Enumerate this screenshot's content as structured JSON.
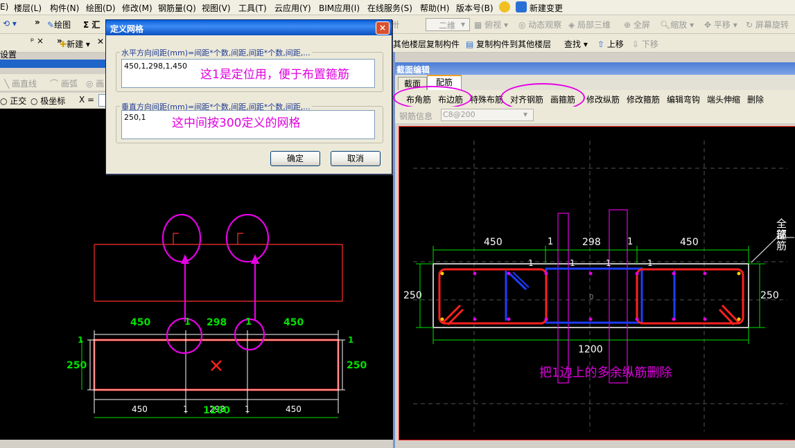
{
  "menubar": {
    "items": [
      "E)",
      "楼层(L)",
      "构件(N)",
      "绘图(D)",
      "修改(M)",
      "钢筋量(Q)",
      "视图(V)",
      "工具(T)",
      "云应用(Y)",
      "BIM应用(I)",
      "在线服务(S)",
      "帮助(H)",
      "版本号(B)",
      "新建变更"
    ]
  },
  "toolbar1": {
    "undo": "⟲ ▾",
    "draw": "绘图",
    "sum": "Σ 汇",
    "right_items": [
      "二维",
      "俯视",
      "动态观察",
      "局部三维",
      "全屏",
      "缩放",
      "平移",
      "屏幕旋转"
    ]
  },
  "toolbar2": {
    "panel_label": "设置",
    "pin": "ᵖ ×",
    "new_button": "新建",
    "copy_from_other": "其他楼层复制构件",
    "copy_to_other": "复制构件到其他楼层",
    "find": "查找",
    "up": "上移",
    "down": "下移"
  },
  "left_panel": {
    "tools": [
      "画直线",
      "画弧",
      "画"
    ],
    "ortho": "正交",
    "polar": "极坐标",
    "x_label": "X ="
  },
  "dialog": {
    "title": "定义网格",
    "close": "×",
    "h_group_label": "水平方向间距(mm)=间距*个数,间距,间距*个数,间距,...",
    "h_value": "450,1,298,1,450",
    "h_note": "这1是定位用，便于布置箍筋",
    "v_group_label": "垂直方向间距(mm)=间距*个数,间距,间距*个数,间距,...",
    "v_value": "250,1",
    "v_note": "这中间按300定义的网格",
    "ok": "确定",
    "cancel": "取消"
  },
  "left_drawing": {
    "dims_top": [
      "450",
      "1",
      "298",
      "1",
      "450"
    ],
    "left_top_dim": "1",
    "right_top_dim": "1",
    "left_dim": "250",
    "right_dim": "250",
    "dims_bottom": [
      "450",
      "1",
      "298",
      "1",
      "450"
    ],
    "total": "1200"
  },
  "section_editor": {
    "title": "截面编辑",
    "tabs": [
      "截面",
      "配筋"
    ],
    "tools": [
      "布角筋",
      "布边筋",
      "特殊布筋",
      "对齐钢筋",
      "画箍筋",
      "修改纵筋",
      "修改箍筋",
      "编辑弯钩",
      "端头伸缩",
      "删除"
    ],
    "rebar_info_label": "钢筋信息",
    "rebar_info_value": "C8@200",
    "annotation_right": [
      "全部",
      "箍筋"
    ],
    "note": "把1边上的多余纵筋删除",
    "dims_top": [
      "450",
      "1",
      "298",
      "1",
      "450"
    ],
    "dims_inner": [
      "1",
      "1",
      "1",
      "1"
    ],
    "left_dim": "250",
    "right_dim": "250",
    "total": "1200",
    "center_mark": "0"
  },
  "colors": {
    "magenta": "#e600e6",
    "red": "#ff2020",
    "green": "#00e000",
    "blue": "#1e3cff"
  }
}
